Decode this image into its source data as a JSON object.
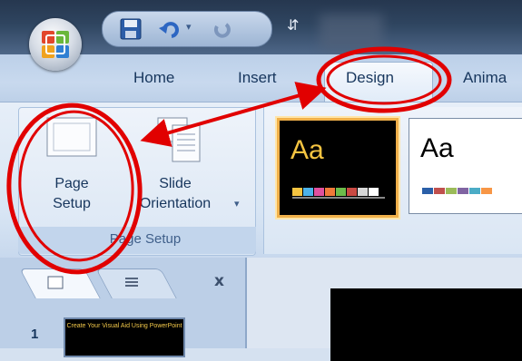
{
  "tabs": [
    "Home",
    "Insert",
    "Design",
    "Anima"
  ],
  "page_setup_button": {
    "line1": "Page",
    "line2": "Setup"
  },
  "slide_orientation_button": {
    "line1": "Slide",
    "line2": "Orientation"
  },
  "group_title": "Page Setup",
  "themes": [
    {
      "label": "Aa",
      "background": "#000000",
      "text_color": "#f5c441",
      "swatches": [
        "#f5c441",
        "#4db2e9",
        "#e0509e",
        "#f07a3a",
        "#6dbb4b",
        "#c94a43",
        "#d8d8d8",
        "#ffffff"
      ]
    },
    {
      "label": "Aa",
      "background": "#ffffff",
      "text_color": "#000000",
      "swatches": [
        "#2a5fa8",
        "#c0504d",
        "#9bbb59",
        "#8064a2",
        "#4bacc6",
        "#f79646"
      ]
    }
  ],
  "panel_close": "x",
  "slide_number": "1",
  "thumbnail_title": "Create Your Visual Aid Using PowerPoint",
  "colors": {
    "annotation": "#e10000",
    "accent_highlight": "#f0b04a",
    "ribbon_text": "#17365d"
  }
}
